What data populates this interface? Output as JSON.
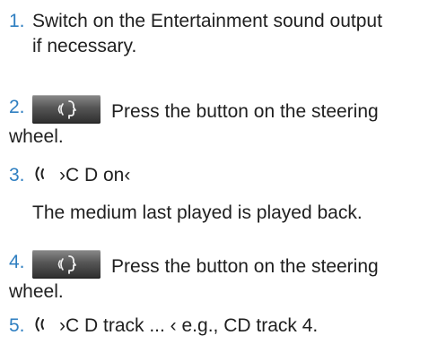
{
  "steps": [
    {
      "number": "1.",
      "line1": "Switch on the Entertainment sound output",
      "line2": "if necessary."
    },
    {
      "number": "2.",
      "icon": "voice-button-icon",
      "line1": "Press the button on the steering",
      "line2": "wheel."
    },
    {
      "number": "3.",
      "icon": "voice-command-icon",
      "command": "›C D on‹",
      "result": "The medium last played is played back."
    },
    {
      "number": "4.",
      "icon": "voice-button-icon",
      "line1": "Press the button on the steering",
      "line2": "wheel."
    },
    {
      "number": "5.",
      "icon": "voice-command-icon",
      "command": "›C D track ... ‹ e.g., CD track 4."
    }
  ],
  "colors": {
    "number": "#2f7fc1",
    "text": "#1f1f1f",
    "button_top": "#8a8a8a",
    "button_bottom": "#2d2d2d"
  }
}
